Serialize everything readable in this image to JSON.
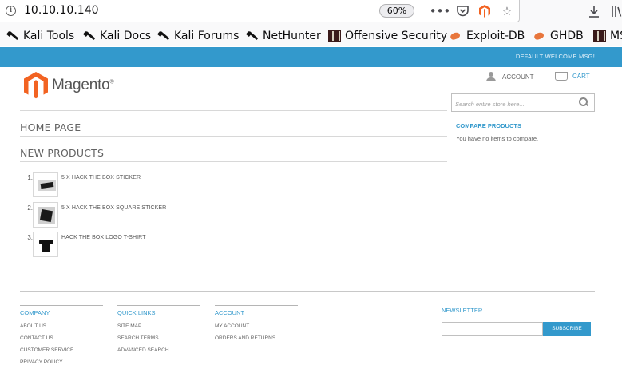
{
  "browser": {
    "url": "10.10.10.140",
    "zoom": "60%",
    "bookmarks": [
      {
        "label": "Kali Tools",
        "icon": "kali-dragon-icon"
      },
      {
        "label": "Kali Docs",
        "icon": "kali-dragon-icon"
      },
      {
        "label": "Kali Forums",
        "icon": "kali-dragon-icon"
      },
      {
        "label": "NetHunter",
        "icon": "kali-dragon-icon"
      },
      {
        "label": "Offensive Security",
        "icon": "offsec-icon"
      },
      {
        "label": "Exploit-DB",
        "icon": "exploit-db-icon"
      },
      {
        "label": "GHDB",
        "icon": "exploit-db-icon"
      },
      {
        "label": "MS",
        "icon": "offsec-icon"
      }
    ]
  },
  "store": {
    "welcome": "DEFAULT WELCOME MSG!",
    "logo_text": "Magento",
    "logo_mark": "®",
    "account_label": "ACCOUNT",
    "cart_label": "CART",
    "search_placeholder": "Search entire store here...",
    "brand_color": "#3399cc",
    "logo_color": "#f26322"
  },
  "main": {
    "page_title": "HOME PAGE",
    "section_title": "NEW PRODUCTS",
    "products": [
      {
        "num": "1.",
        "name": "5 X HACK THE BOX STICKER",
        "thumb": "sticker"
      },
      {
        "num": "2.",
        "name": "5 X HACK THE BOX SQUARE STICKER",
        "thumb": "square-sticker"
      },
      {
        "num": "3.",
        "name": "HACK THE BOX LOGO T-SHIRT",
        "thumb": "t-shirt"
      }
    ]
  },
  "sidebar": {
    "compare_title": "COMPARE PRODUCTS",
    "compare_text": "You have no items to compare."
  },
  "footer": {
    "columns": [
      {
        "title": "COMPANY",
        "links": [
          "ABOUT US",
          "CONTACT US",
          "CUSTOMER SERVICE",
          "PRIVACY POLICY"
        ]
      },
      {
        "title": "QUICK LINKS",
        "links": [
          "SITE MAP",
          "SEARCH TERMS",
          "ADVANCED SEARCH"
        ]
      },
      {
        "title": "ACCOUNT",
        "links": [
          "MY ACCOUNT",
          "ORDERS AND RETURNS"
        ]
      }
    ],
    "newsletter_title": "NEWSLETTER",
    "subscribe_label": "SUBSCRIBE"
  }
}
